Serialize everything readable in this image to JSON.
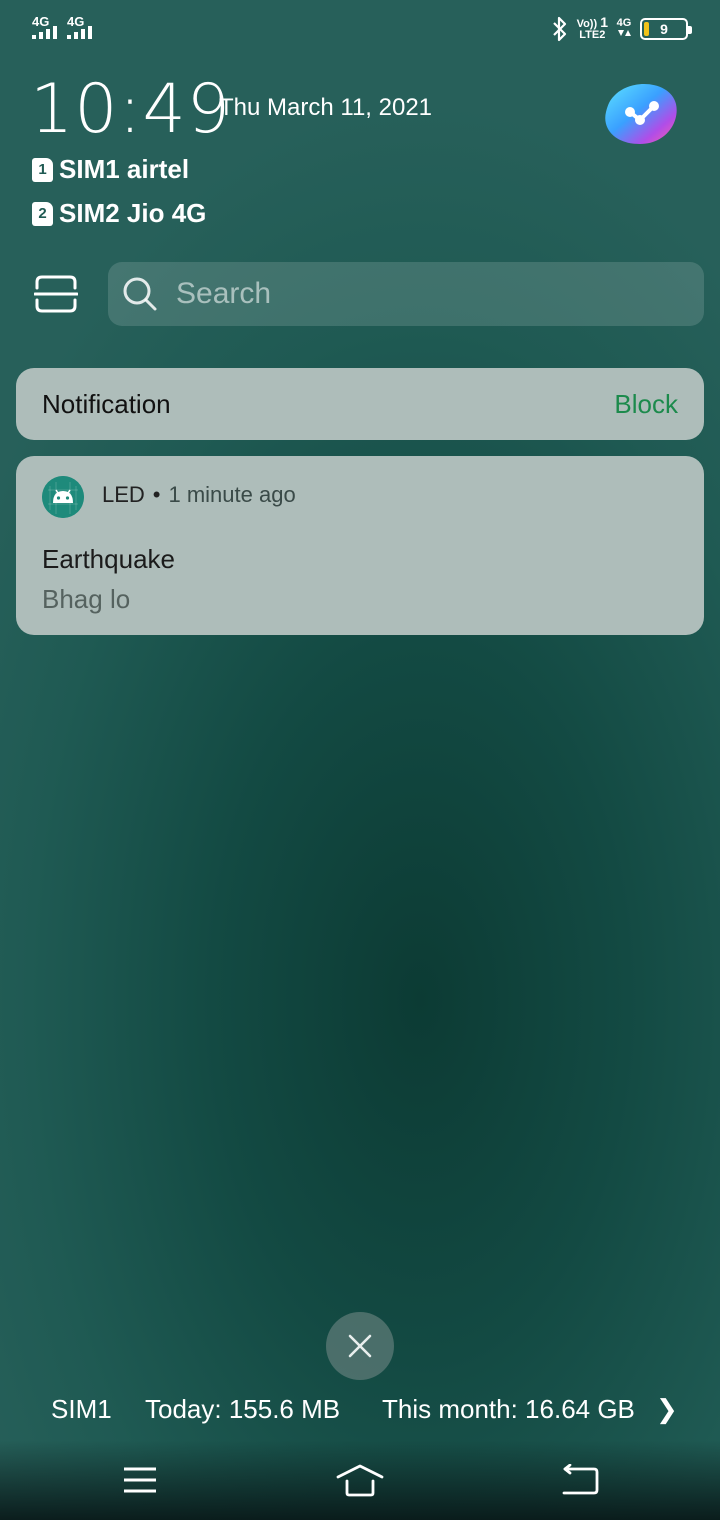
{
  "status_bar": {
    "sim1_network": "4G",
    "sim2_network": "4G",
    "volte_top": "Vo))",
    "volte_bottom": "LTE2",
    "volte_sim": "1",
    "data_network": "4G",
    "battery_level": "9",
    "battery_color": "#f2c31a"
  },
  "header": {
    "time": "10:49",
    "date": "Thu March 11, 2021"
  },
  "sims": [
    {
      "slot": "1",
      "label": "SIM1 airtel"
    },
    {
      "slot": "2",
      "label": "SIM2 Jio 4G"
    }
  ],
  "search": {
    "placeholder": "Search"
  },
  "notification_header": {
    "title": "Notification",
    "block_label": "Block",
    "block_color": "#1c8a4c"
  },
  "notification": {
    "app_name": "LED",
    "separator": "•",
    "time": "1 minute ago",
    "title": "Earthquake",
    "body": "Bhag lo",
    "icon": "android-icon"
  },
  "data_usage": {
    "sim": "SIM1",
    "today": "Today: 155.6 MB",
    "month": "This month: 16.64 GB",
    "chevron": "❯"
  },
  "navbar": {
    "icons": [
      "menu-icon",
      "home-icon",
      "back-icon"
    ]
  }
}
